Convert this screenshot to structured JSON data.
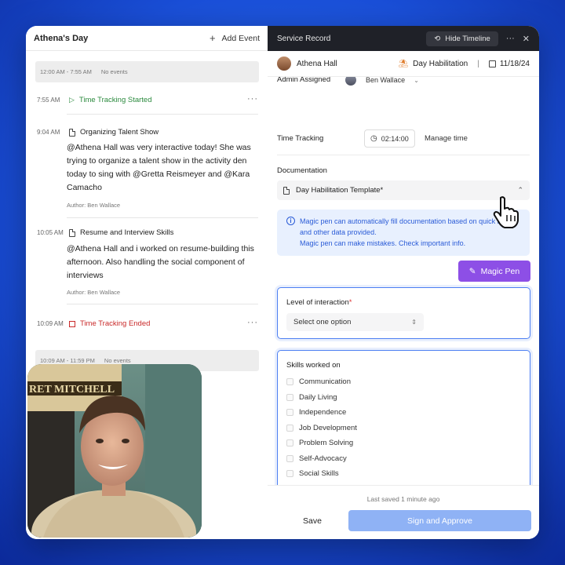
{
  "left_panel": {
    "title": "Athena's Day",
    "add_event_label": "Add Event",
    "no_events_1": {
      "range": "12:00 AM - 7:55 AM",
      "text": "No events"
    },
    "events": [
      {
        "time": "7:55 AM",
        "title": "Time Tracking Started"
      },
      {
        "time": "9:04 AM",
        "title": "Organizing Talent Show",
        "body": "@Athena Hall was very interactive today! She was trying to organize a talent show in the activity den today to sing with @Gretta Reismeyer and @Kara Camacho",
        "author": "Author: Ben Wallace"
      },
      {
        "time": "10:05 AM",
        "title": "Resume and Interview Skills",
        "body": "@Athena Hall and i worked on resume-building this afternoon. Also handling the social component of interviews",
        "author": "Author: Ben Wallace"
      },
      {
        "time": "10:09 AM",
        "title": "Time Tracking Ended"
      }
    ],
    "no_events_2": {
      "range": "10:09 AM - 11:59 PM",
      "text": "No events"
    },
    "webcam_sign": "RET MITCHELL"
  },
  "right_panel": {
    "title": "Service Record",
    "hide_timeline_label": "Hide Timeline",
    "client_name": "Athena Hall",
    "service_type": "Day Habilitation",
    "date": "11/18/24",
    "admin_assigned_label": "Admin Assigned",
    "admin_name": "Ben Wallace",
    "time_tracking_label": "Time Tracking",
    "time_tracking_value": "02:14:00",
    "manage_time_label": "Manage time",
    "documentation_label": "Documentation",
    "template_name": "Day Habilitation Template*",
    "info_text_1": "Magic pen can automatically fill documentation based on quick notes and other data provided.",
    "info_text_2": "Magic pen can make mistakes. Check important info.",
    "magic_pen_label": "Magic Pen",
    "level_label": "Level of interaction",
    "level_required": "*",
    "level_placeholder": "Select one option",
    "skills_label": "Skills worked on",
    "skills": [
      "Communication",
      "Daily Living",
      "Independence",
      "Job Development",
      "Problem Solving",
      "Self-Advocacy",
      "Social Skills"
    ],
    "last_saved": "Last saved 1 minute ago",
    "save_label": "Save",
    "sign_label": "Sign and Approve"
  },
  "colors": {
    "accent_blue": "#4c7ff2",
    "magic_purple": "#8d4fe6",
    "started_green": "#2b8a3e",
    "ended_red": "#c92a2a",
    "header_dark": "#1f2128"
  }
}
